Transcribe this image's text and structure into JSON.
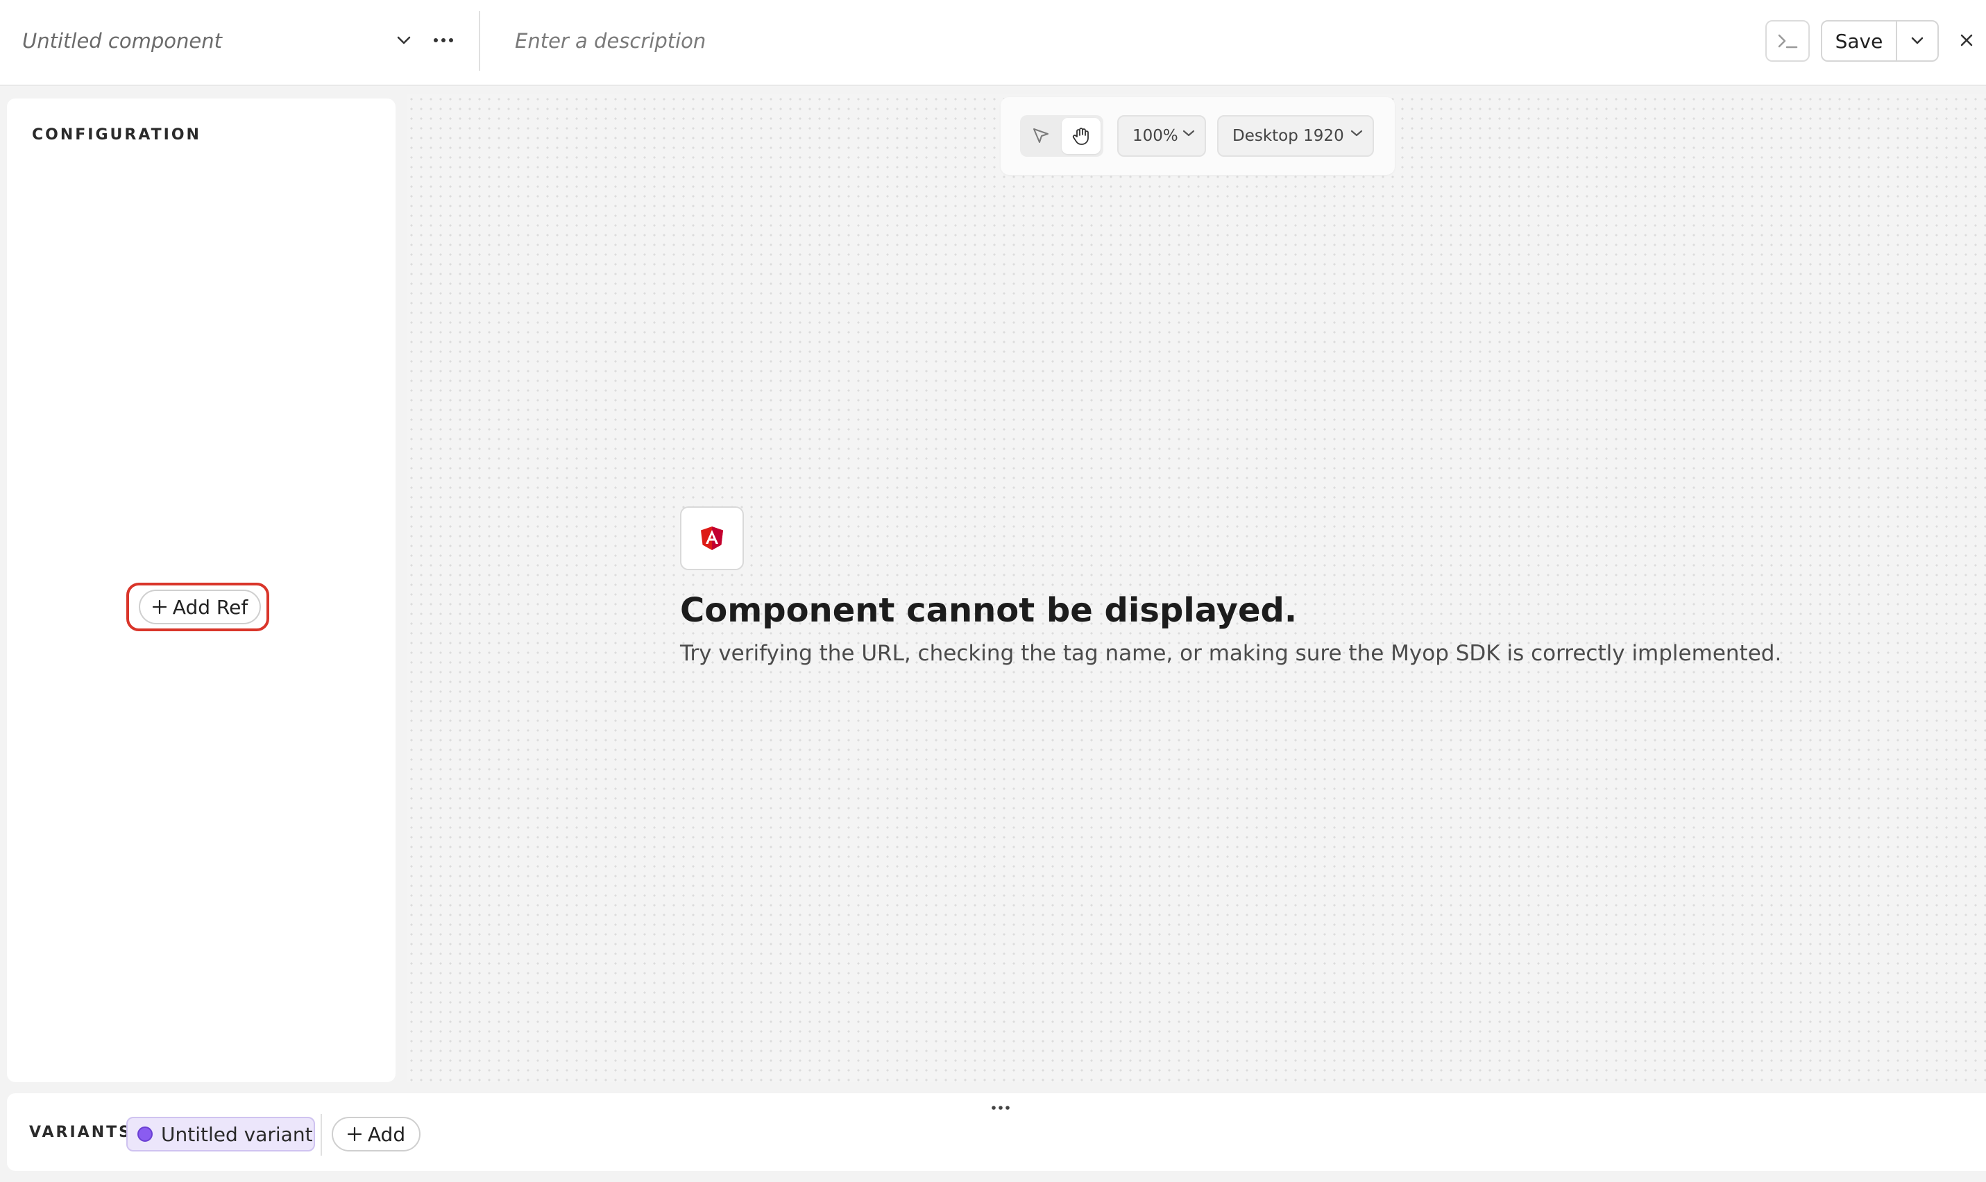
{
  "header": {
    "title_placeholder": "Untitled component",
    "description_placeholder": "Enter a description",
    "save_label": "Save"
  },
  "icons": {
    "title_dropdown": "chevron-down-icon",
    "more": "more-horizontal-icon",
    "console": "terminal-icon",
    "save_dropdown": "chevron-down-icon",
    "close": "close-icon",
    "select_tool": "cursor-arrow-icon",
    "hand_tool": "hand-icon",
    "framework": "angular-logo-icon"
  },
  "config": {
    "title": "CONFIGURATION",
    "add_ref_label": "Add Ref"
  },
  "toolbar": {
    "zoom": "100%",
    "device": "Desktop 1920"
  },
  "canvas": {
    "error_title": "Component cannot be displayed.",
    "error_message": "Try verifying the URL, checking the tag name, or making sure the Myop SDK is correctly implemented."
  },
  "variants": {
    "label": "VARIANTS",
    "items": [
      {
        "label": "Untitled variant",
        "color": "#8a5cf0"
      }
    ],
    "add_label": "Add"
  },
  "colors": {
    "highlight": "#d9352a",
    "angular_red": "#dd1b16",
    "variant_bg": "#ece6fb"
  }
}
